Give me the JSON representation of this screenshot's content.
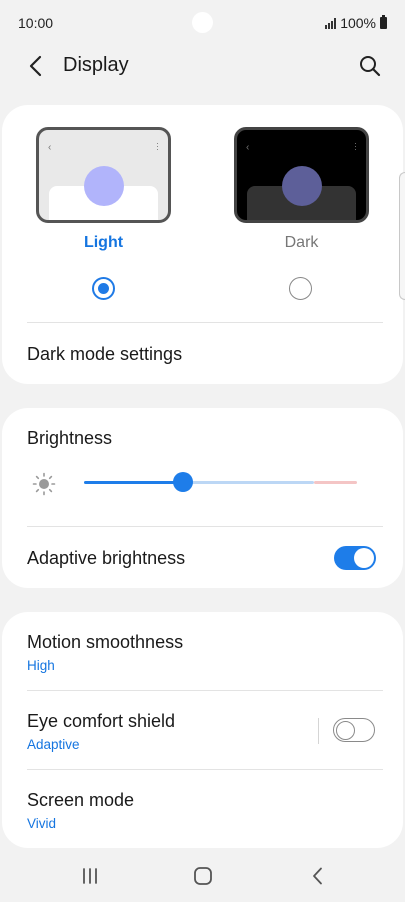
{
  "status_bar": {
    "time": "10:00",
    "battery": "100%"
  },
  "header": {
    "title": "Display"
  },
  "theme": {
    "options": [
      {
        "label": "Light",
        "selected": true
      },
      {
        "label": "Dark",
        "selected": false
      }
    ],
    "dark_mode_settings": "Dark mode settings"
  },
  "brightness": {
    "title": "Brightness",
    "level": 0.36,
    "adaptive_label": "Adaptive brightness",
    "adaptive_on": true
  },
  "settings": [
    {
      "title": "Motion smoothness",
      "value": "High"
    },
    {
      "title": "Eye comfort shield",
      "value": "Adaptive",
      "toggle_on": false
    },
    {
      "title": "Screen mode",
      "value": "Vivid"
    }
  ],
  "colors": {
    "accent": "#1e7de9",
    "background": "#f2f2f2",
    "card": "#ffffff"
  }
}
